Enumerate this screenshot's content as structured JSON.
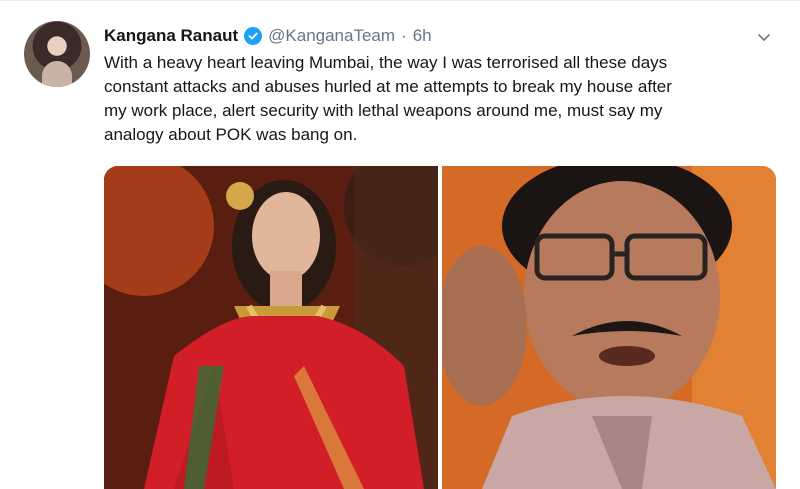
{
  "tweet": {
    "author_name": "Kangana Ranaut",
    "handle": "@KanganaTeam",
    "separator": "·",
    "time": "6h",
    "text_lines": [
      "With a heavy heart leaving Mumbai, the way I was terrorised all these days",
      "constant attacks and abuses hurled at me attempts to break my house after",
      "my work place, alert security with lethal weapons around me, must say my",
      "analogy about POK was bang on."
    ],
    "verified": true
  },
  "icons": {
    "verified": "verified-badge-icon",
    "menu": "chevron-down-icon"
  },
  "colors": {
    "accent": "#1da1f2",
    "secondary_text": "#657786",
    "primary_text": "#14171a"
  }
}
